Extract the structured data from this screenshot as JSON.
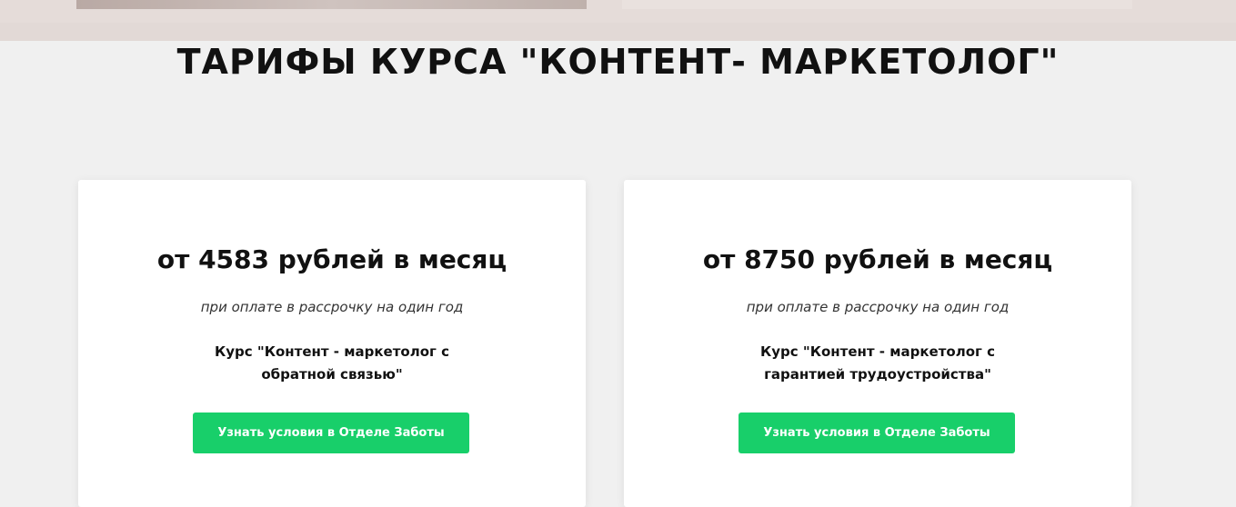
{
  "colors": {
    "background": "#f0f0f0",
    "card": "#ffffff",
    "accent_button": "#18cf6a",
    "title_text": "#111111"
  },
  "section": {
    "title": "ТАРИФЫ КУРСА \"КОНТЕНТ- МАРКЕТОЛОГ\""
  },
  "plans": [
    {
      "price": "от 4583 рублей в месяц",
      "note": "при оплате в рассрочку на один год",
      "course_line1": "Курс \"Контент - маркетолог с",
      "course_line2": "обратной связью\"",
      "button_label": "Узнать условия в Отделе Заботы"
    },
    {
      "price": "от 8750 рублей в месяц",
      "note": "при оплате в рассрочку на один год",
      "course_line1": "Курс \"Контент - маркетолог с",
      "course_line2": "гарантией трудоустройства\"",
      "button_label": "Узнать условия в Отделе Заботы"
    }
  ]
}
